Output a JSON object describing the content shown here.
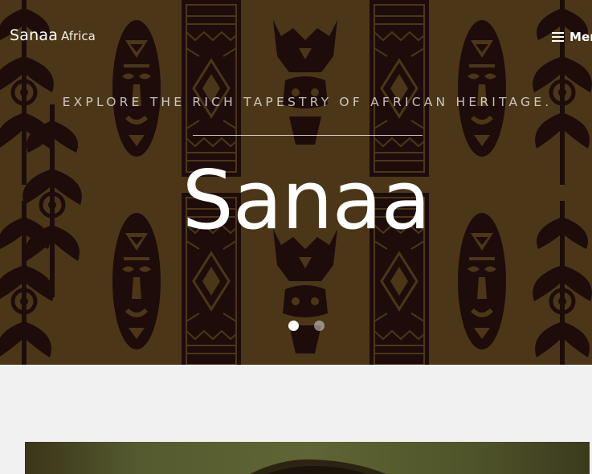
{
  "brand": {
    "name": "Sanaa",
    "suffix": "Africa"
  },
  "nav": {
    "menu_label": "Menu",
    "menu_icon": "hamburger-icon"
  },
  "hero": {
    "tagline": "EXPLORE THE RICH TAPESTRY OF AFRICAN HERITAGE.",
    "title": "Sanaa",
    "slides": {
      "count": 2,
      "active": 1
    }
  },
  "colors": {
    "hero_bg": "#4b3718",
    "pattern": "#1d0c0a",
    "page_bg": "#f1f1f1"
  },
  "feature_image": {
    "icon": "feature-photo"
  }
}
